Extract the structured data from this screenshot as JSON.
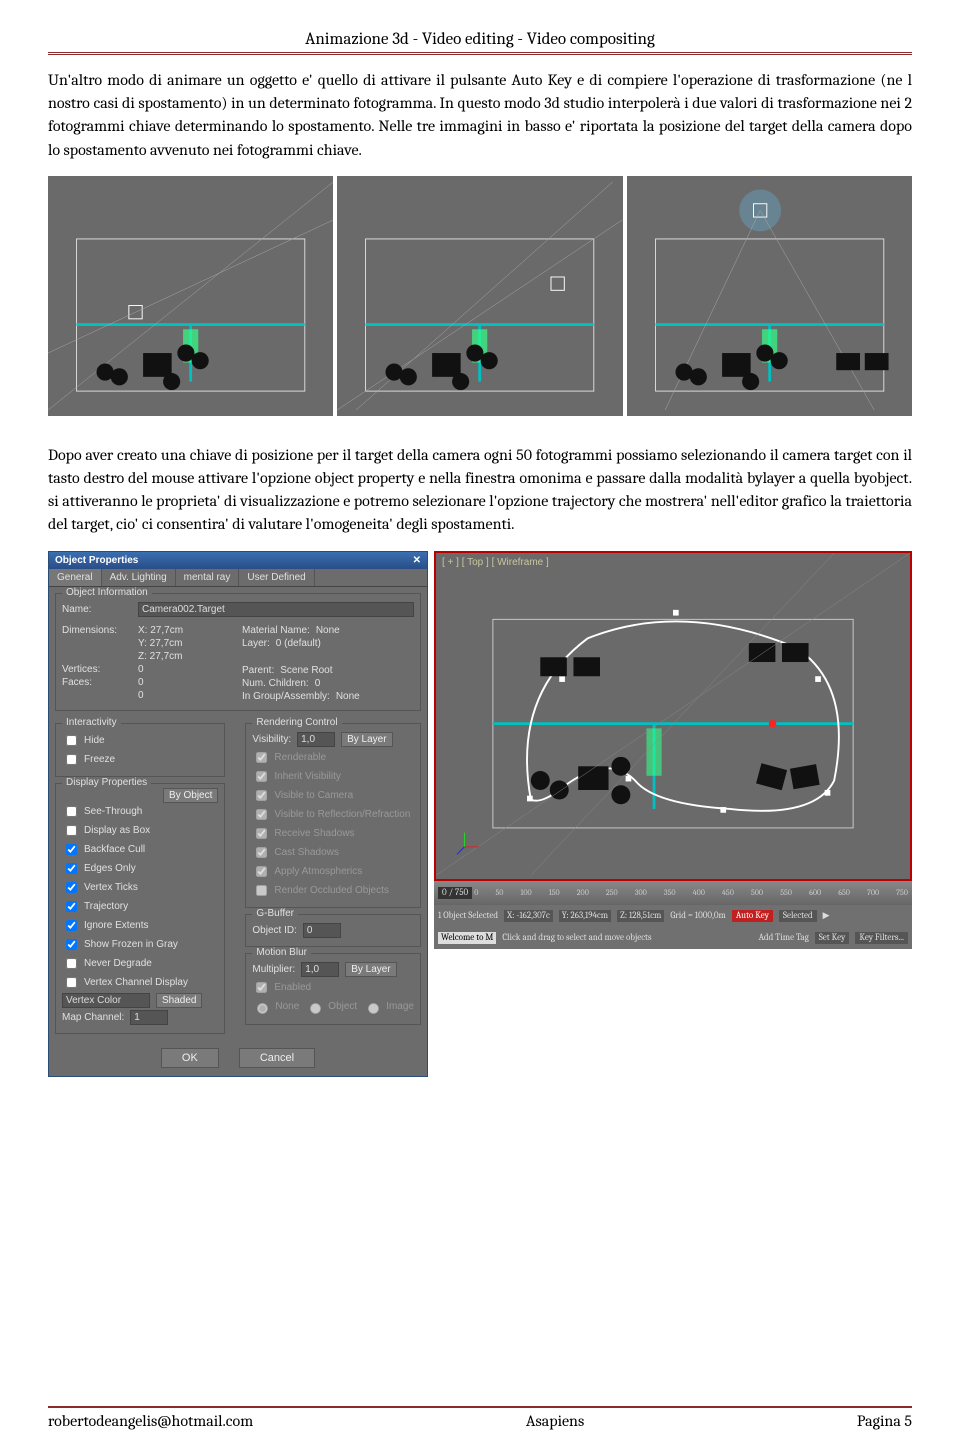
{
  "header": {
    "title": "Animazione 3d - Video editing - Video compositing"
  },
  "para1": "Un'altro modo di animare un oggetto e' quello di attivare il pulsante Auto Key e di compiere l'operazione di trasformazione (ne l nostro casi di spostamento) in un determinato fotogramma. In questo modo 3d studio interpolerà i due valori di trasformazione nei 2 fotogrammi chiave determinando lo spostamento. Nelle tre immagini in basso e' riportata la posizione del target della camera dopo lo spostamento avvenuto nei fotogrammi chiave.",
  "para2": "Dopo aver creato una chiave di posizione per il target della camera ogni 50 fotogrammi possiamo selezionando il camera target con il tasto destro del mouse attivare l'opzione object property e nella finestra omonima  e passare dalla modalità bylayer a quella byobject. si attiveranno le proprieta' di visualizzazione  e potremo selezionare l'opzione trajectory che mostrera' nell'editor grafico la traiettoria del target, cio' ci consentira' di valutare l'omogeneita' degli spostamenti.",
  "dialog": {
    "title": "Object Properties",
    "tabs": [
      "General",
      "Adv. Lighting",
      "mental ray",
      "User Defined"
    ],
    "objinfo": {
      "section": "Object Information",
      "name_lbl": "Name:",
      "name": "Camera002.Target",
      "dims_lbl": "Dimensions:",
      "x": "X: 27,7cm",
      "y": "Y: 27,7cm",
      "z": "Z: 27,7cm",
      "matname_lbl": "Material Name:",
      "matname": "None",
      "layer_lbl": "Layer:",
      "layer": "0 (default)",
      "verts_lbl": "Vertices:",
      "verts": "0",
      "faces_lbl": "Faces:",
      "faces": "0",
      "parent_lbl": "Parent:",
      "parent": "Scene Root",
      "children_lbl": "Num. Children:",
      "children": "0",
      "ingroup_lbl": "In Group/Assembly:",
      "ingroup": "None"
    },
    "interactivity": {
      "section": "Interactivity",
      "hide": "Hide",
      "freeze": "Freeze"
    },
    "display": {
      "section": "Display Properties",
      "byobject": "By Object",
      "seethrough": "See-Through",
      "displayasbox": "Display as Box",
      "backface": "Backface Cull",
      "edgesonly": "Edges Only",
      "vertexticks": "Vertex Ticks",
      "trajectory": "Trajectory",
      "ignoreextents": "Ignore Extents",
      "showfrozen": "Show Frozen in Gray",
      "neverdegrade": "Never Degrade",
      "vertexchan": "Vertex Channel Display",
      "vertexcolor": "Vertex Color",
      "shaded": "Shaded",
      "mapchannel_lbl": "Map Channel:",
      "mapchannel": "1"
    },
    "rendering": {
      "section": "Rendering Control",
      "vis_lbl": "Visibility:",
      "vis": "1,0",
      "bylayer": "By Layer",
      "renderable": "Renderable",
      "inheritvis": "Inherit Visibility",
      "visiblecam": "Visible to Camera",
      "visrefl": "Visible to Reflection/Refraction",
      "recvshad": "Receive Shadows",
      "castshad": "Cast Shadows",
      "applyatmo": "Apply Atmospherics",
      "renderocc": "Render Occluded Objects"
    },
    "gbuffer": {
      "section": "G-Buffer",
      "objid_lbl": "Object ID:",
      "objid": "0"
    },
    "mblur": {
      "section": "Motion Blur",
      "mult_lbl": "Multiplier:",
      "mult": "1,0",
      "bylayer": "By Layer",
      "enabled": "Enabled",
      "none": "None",
      "object": "Object",
      "image": "Image"
    },
    "ok": "OK",
    "cancel": "Cancel"
  },
  "viewport": {
    "label": "[ + ] [ Top ] [ Wireframe ]",
    "frame": "0 / 750",
    "ticks": [
      "0",
      "50",
      "100",
      "150",
      "200",
      "250",
      "300",
      "350",
      "400",
      "450",
      "500",
      "550",
      "600",
      "650",
      "700",
      "750"
    ],
    "status_sel": "1 Object Selected",
    "status_x": "X: -162,307c",
    "status_y": "Y: 263,194cm",
    "status_z": "Z: 128,51cm",
    "grid": "Grid = 1000,0m",
    "autokey": "Auto Key",
    "selected": "Selected",
    "setkey": "Set Key",
    "keyfilters": "Key Filters...",
    "welcome": "Welcome to M",
    "hint": "Click and drag to select and move objects",
    "addtag": "Add Time Tag"
  },
  "footer": {
    "left": "robertodeangelis@hotmail.com",
    "center": "Asapiens",
    "right": "Pagina 5"
  }
}
